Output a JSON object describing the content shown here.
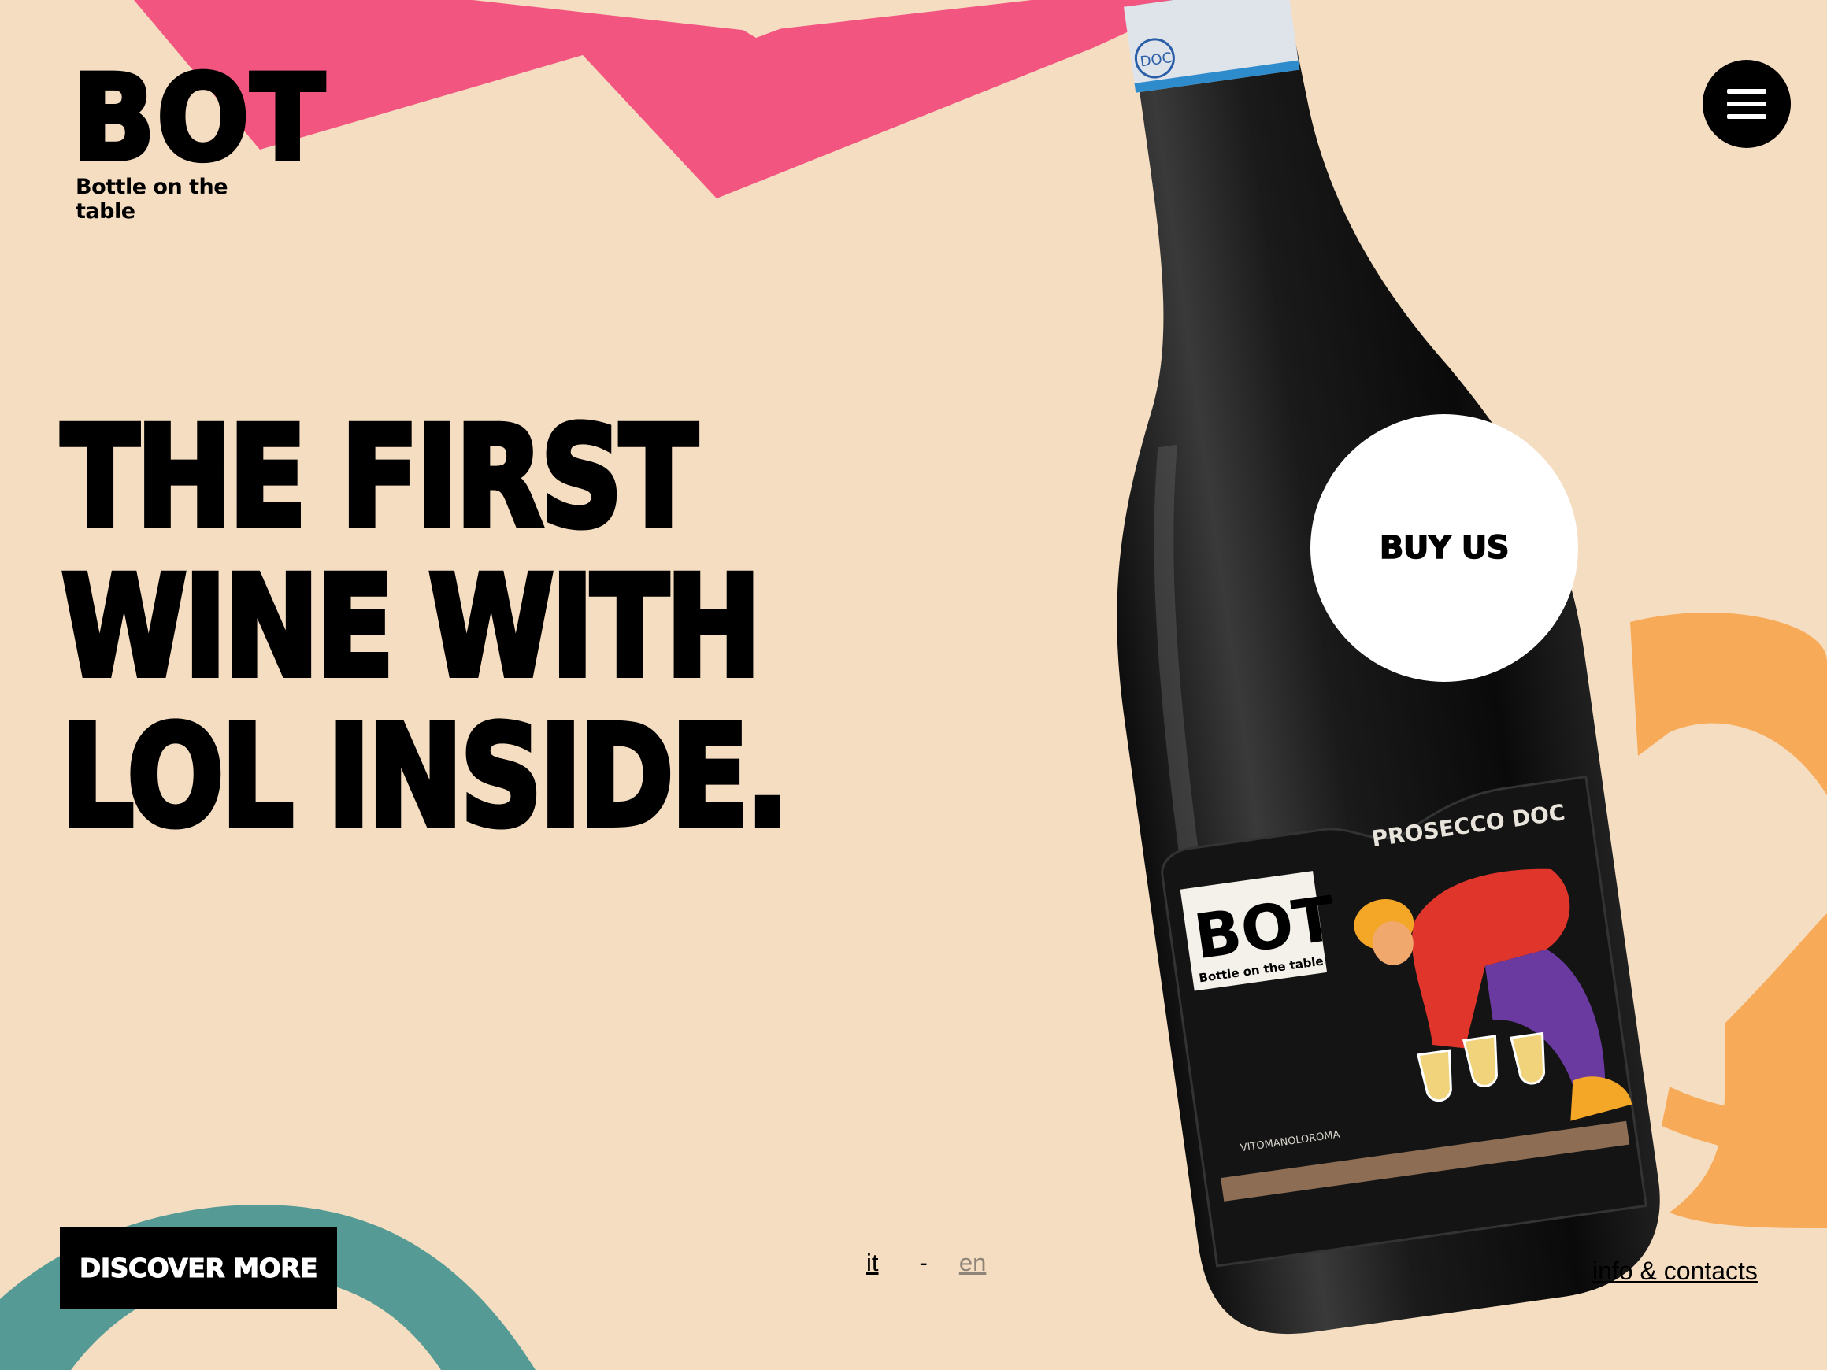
{
  "brand": {
    "logo_text": "BOT",
    "tagline": "Bottle on the table"
  },
  "hero": {
    "headline_lines": [
      "THE FIRST",
      "WINE WITH",
      "LOL INSIDE."
    ]
  },
  "actions": {
    "buy_label": "BUY US",
    "discover_label": "DISCOVER MORE"
  },
  "language": {
    "it": "it",
    "separator": "-",
    "en": "en"
  },
  "footer": {
    "info_link": "info & contacts"
  },
  "bottle_label": {
    "logo_text": "BOT",
    "tagline": "Bottle on the table",
    "wine_name": "PROSECCO DOC",
    "artist": "VITOMANOLOROMA",
    "capsule_badge": "DOC"
  },
  "icons": {
    "menu": "hamburger-icon"
  },
  "colors": {
    "background": "#f5ddc1",
    "pink": "#f25680",
    "orange": "#f7ab58",
    "teal": "#559a94",
    "black": "#000000",
    "white": "#ffffff"
  }
}
